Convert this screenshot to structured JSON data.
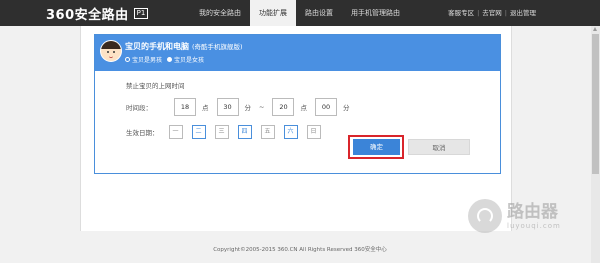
{
  "header": {
    "brand": "360安全路由",
    "version_badge": "P1",
    "nav": [
      "我的安全路由",
      "功能扩展",
      "路由设置",
      "用手机管理路由"
    ],
    "active_index": 1,
    "links": [
      "客服专区",
      "去官网",
      "退出管理"
    ],
    "link_sep": "|"
  },
  "card": {
    "title": "宝贝的手机和电脑",
    "subtitle": "(奇酷手机旗舰版)",
    "gender_options": [
      "宝贝是男孩",
      "宝贝是女孩"
    ],
    "gender_selected": 1
  },
  "rule": {
    "title": "禁止宝贝的上网时间",
    "time_label": "时间段：",
    "start_hour": "18",
    "hour_unit_1": "点",
    "start_min": "30",
    "min_unit_1": "分",
    "dash": "~",
    "end_hour": "20",
    "hour_unit_2": "点",
    "end_min": "00",
    "min_unit_2": "分",
    "days_label": "生效日期：",
    "days": [
      "一",
      "二",
      "三",
      "四",
      "五",
      "六",
      "日"
    ],
    "days_selected": [
      1,
      3,
      5
    ]
  },
  "buttons": {
    "ok": "确定",
    "cancel": "取消"
  },
  "footer": {
    "copyright": "Copyright©2005-2015 360.CN All Rights Reserved 360安全中心"
  },
  "watermark": {
    "big": "路由器",
    "small": "luyouqi.com"
  },
  "colors": {
    "topbar": "#2f2f2f",
    "accent": "#4a90e2",
    "highlight": "#d9252b"
  }
}
